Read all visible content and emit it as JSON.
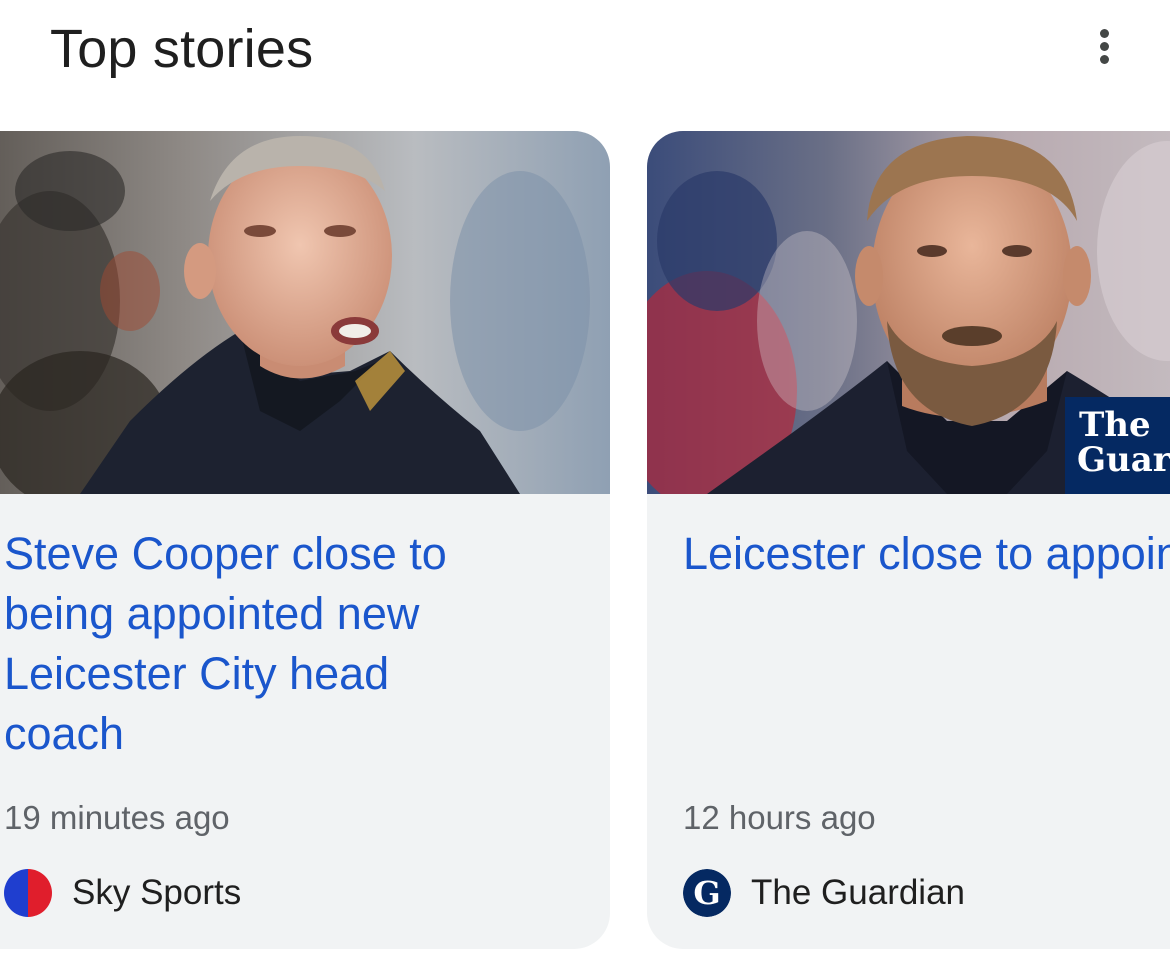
{
  "header": {
    "title": "Top stories",
    "more_icon": "more-vert-icon"
  },
  "stories": [
    {
      "headline": "Steve Cooper close to\nbeing appointed new\nLeicester City head\ncoach",
      "time": "19 minutes ago",
      "source": "Sky Sports",
      "source_icon": "sky-sports-logo",
      "source_colors": [
        "#1f3ecf",
        "#e01e2c"
      ]
    },
    {
      "headline": "Leicester close to\nappointing Graham\nPotter as manager to\nreplace Enzo Maresca",
      "time": "12 hours ago",
      "source": "The Guardian",
      "source_icon": "guardian-logo",
      "source_colors": [
        "#052962",
        "#ffffff"
      ],
      "image_watermark": "The Guardian"
    }
  ],
  "colors": {
    "headline": "#1a56cc",
    "card_bg": "#f1f3f4",
    "meta_text": "#5f6368"
  }
}
